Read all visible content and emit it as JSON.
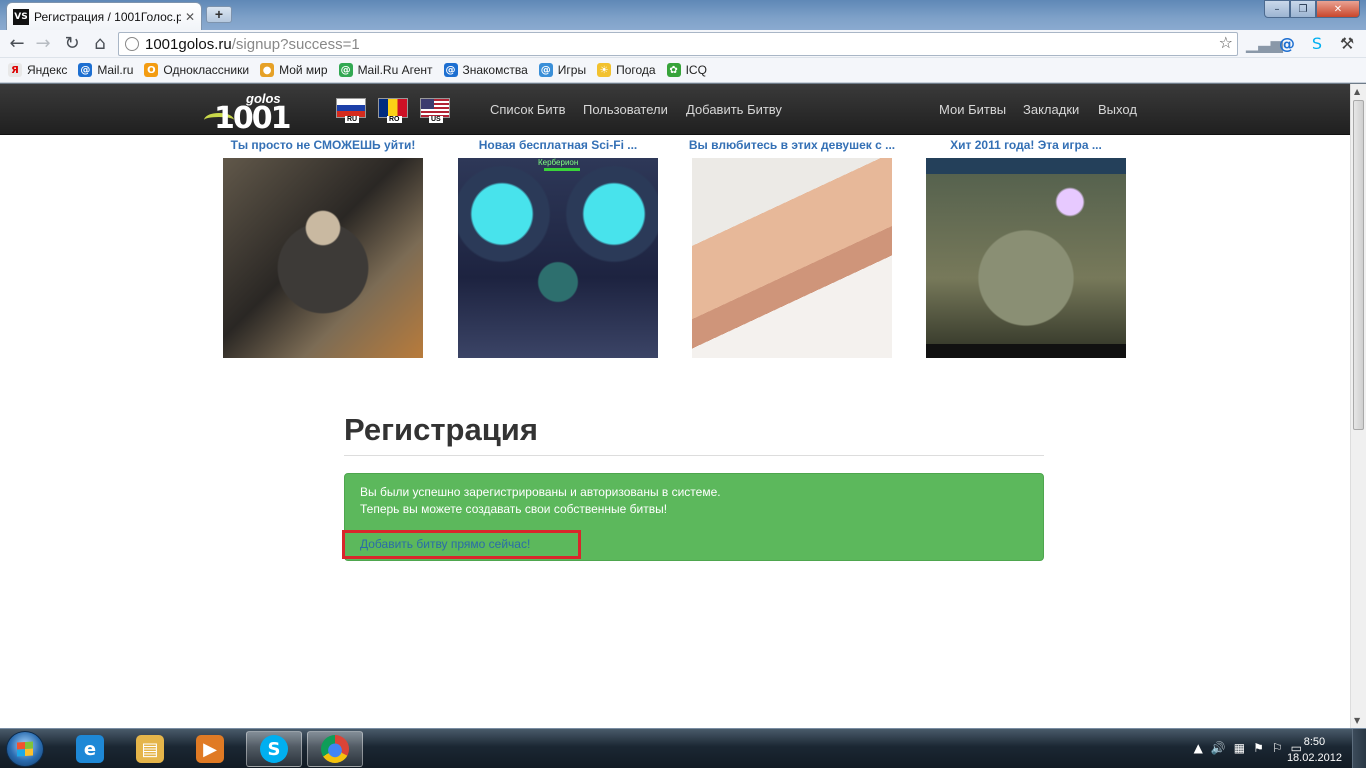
{
  "browser": {
    "tab_title": "Регистрация / 1001Голос.р",
    "tab_favicon": "VS",
    "tab_close": "✕",
    "new_tab": "+",
    "url_host": "1001golos.ru",
    "url_path": "/signup?success=1",
    "nav": {
      "back": "←",
      "forward": "→",
      "reload": "↻",
      "home": "⌂"
    },
    "star": "☆",
    "window": {
      "minimize": "–",
      "maximize": "❐",
      "close": "✕"
    }
  },
  "bookmarks": [
    {
      "label": "Яндекс",
      "icon": "Я",
      "color": "#e8e8e8"
    },
    {
      "label": "Mail.ru",
      "icon": "@",
      "color": "#1d6fd1"
    },
    {
      "label": "Одноклассники",
      "icon": "О",
      "color": "#f39c12"
    },
    {
      "label": "Мой мир",
      "icon": "●",
      "color": "#e6a127"
    },
    {
      "label": "Mail.Ru Агент",
      "icon": "@",
      "color": "#32a852"
    },
    {
      "label": "Знакомства",
      "icon": "@",
      "color": "#1d6fd1"
    },
    {
      "label": "Игры",
      "icon": "@",
      "color": "#3a8fd8"
    },
    {
      "label": "Погода",
      "icon": "☀",
      "color": "#f2c12e"
    },
    {
      "label": "ICQ",
      "icon": "✿",
      "color": "#37a33a"
    }
  ],
  "site": {
    "logo_digits": "1001",
    "logo_word": "golos",
    "flags": {
      "ru": "RU",
      "ro": "RO",
      "us": "US"
    },
    "nav_left": [
      "Список Битв",
      "Пользователи",
      "Добавить Битву"
    ],
    "nav_right": [
      "Мои Битвы",
      "Закладки",
      "Выход"
    ]
  },
  "ads": [
    {
      "title": "Ты просто не СМОЖЕШЬ уйти!"
    },
    {
      "title": "Новая бесплатная Sci-Fi ...",
      "image_caption": "Керберион"
    },
    {
      "title": "Вы влюбитесь в этих девушек с ..."
    },
    {
      "title": "Хит 2011 года! Эта игра ..."
    }
  ],
  "signup": {
    "heading": "Регистрация",
    "message_line1": "Вы были успешно зарегистрированы и авторизованы в системе.",
    "message_line2": "Теперь вы можете создавать свои собственные битвы!",
    "cta_link": "Добавить битву прямо сейчас!"
  },
  "taskbar": {
    "apps": [
      {
        "name": "ie",
        "glyph": "e",
        "color": "#1e88d6"
      },
      {
        "name": "explorer",
        "glyph": "▤",
        "color": "#e5b54a"
      },
      {
        "name": "media",
        "glyph": "▶",
        "color": "#e07a24"
      },
      {
        "name": "skype",
        "glyph": "S",
        "color": "#00aff0"
      },
      {
        "name": "chrome",
        "glyph": "●",
        "color": "#e0b400"
      }
    ],
    "time": "8:50",
    "date": "18.02.2012"
  }
}
